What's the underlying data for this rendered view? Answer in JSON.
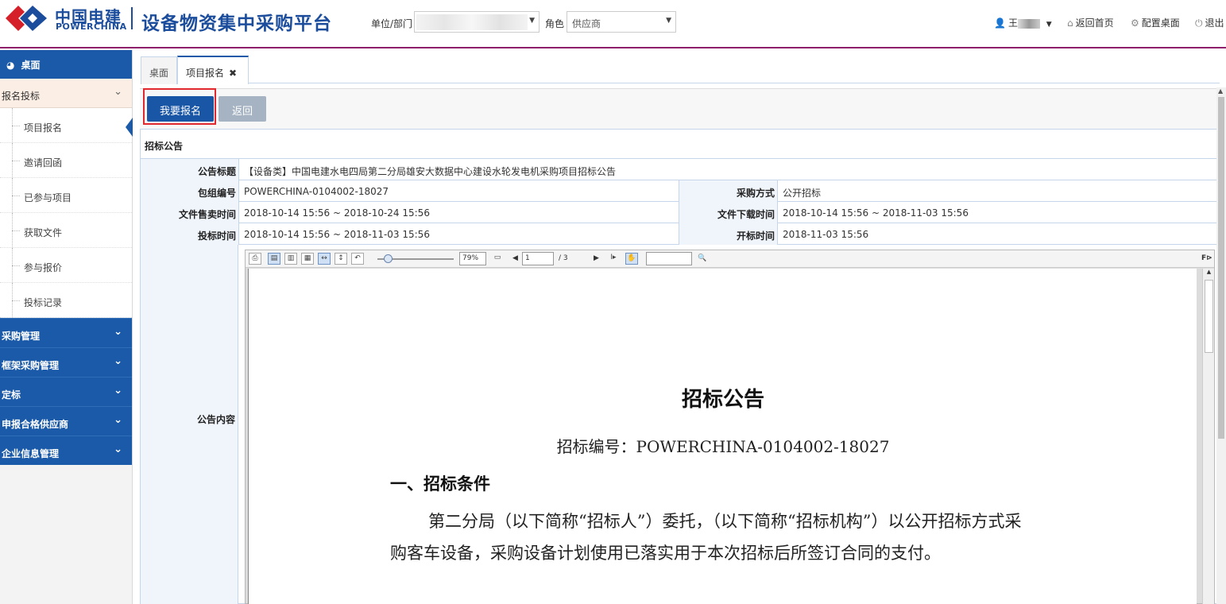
{
  "header": {
    "brand_cn": "中国电建",
    "brand_en": "POWERCHINA",
    "platform_title": "设备物资集中采购平台",
    "unit_label": "单位/部门",
    "role_label": "角色",
    "role_value": "供应商",
    "user_name": "王",
    "home_link": "返回首页",
    "config_link": "配置桌面",
    "logout_link": "退出"
  },
  "sidebar": {
    "desk": "桌面",
    "open_group": "报名投标",
    "sub_items": [
      "项目报名",
      "邀请回函",
      "已参与项目",
      "获取文件",
      "参与报价",
      "投标记录"
    ],
    "groups": [
      "采购管理",
      "框架采购管理",
      "定标",
      "申报合格供应商",
      "企业信息管理"
    ]
  },
  "tabs": [
    "桌面",
    "项目报名"
  ],
  "buttons": {
    "signup": "我要报名",
    "back": "返回"
  },
  "notice": {
    "panel_title": "招标公告",
    "title_label": "公告标题",
    "title_value": "【设备类】中国电建水电四局第二分局雄安大数据中心建设水轮发电机采购项目招标公告",
    "package_label": "包组编号",
    "package_value": "POWERCHINA-0104002-18027",
    "method_label": "采购方式",
    "method_value": "公开招标",
    "sale_label": "文件售卖时间",
    "sale_value": "2018-10-14 15:56 ~ 2018-10-24 15:56",
    "download_label": "文件下载时间",
    "download_value": "2018-10-14 15:56 ~ 2018-11-03 15:56",
    "bid_label": "投标时间",
    "bid_value": "2018-10-14 15:56 ~ 2018-11-03 15:56",
    "open_label": "开标时间",
    "open_value": "2018-11-03 15:56",
    "content_label": "公告内容"
  },
  "pdf": {
    "zoom": "79%",
    "page_current": "1",
    "page_total": "/ 3",
    "doc_title": "招标公告",
    "doc_code": "招标编号：POWERCHINA-0104002-18027",
    "section1": "一、招标条件",
    "paragraph1": "第二分局（以下简称“招标人”）委托，（以下简称“招标机构”）以公开招标方式采购客车设备，采购设备计划使用已落实用于本次招标后所签订合同的支付。"
  },
  "colors": {
    "brand_blue": "#1b5aa8",
    "header_line": "#8e1f6a",
    "highlight_red": "#e0282e"
  }
}
